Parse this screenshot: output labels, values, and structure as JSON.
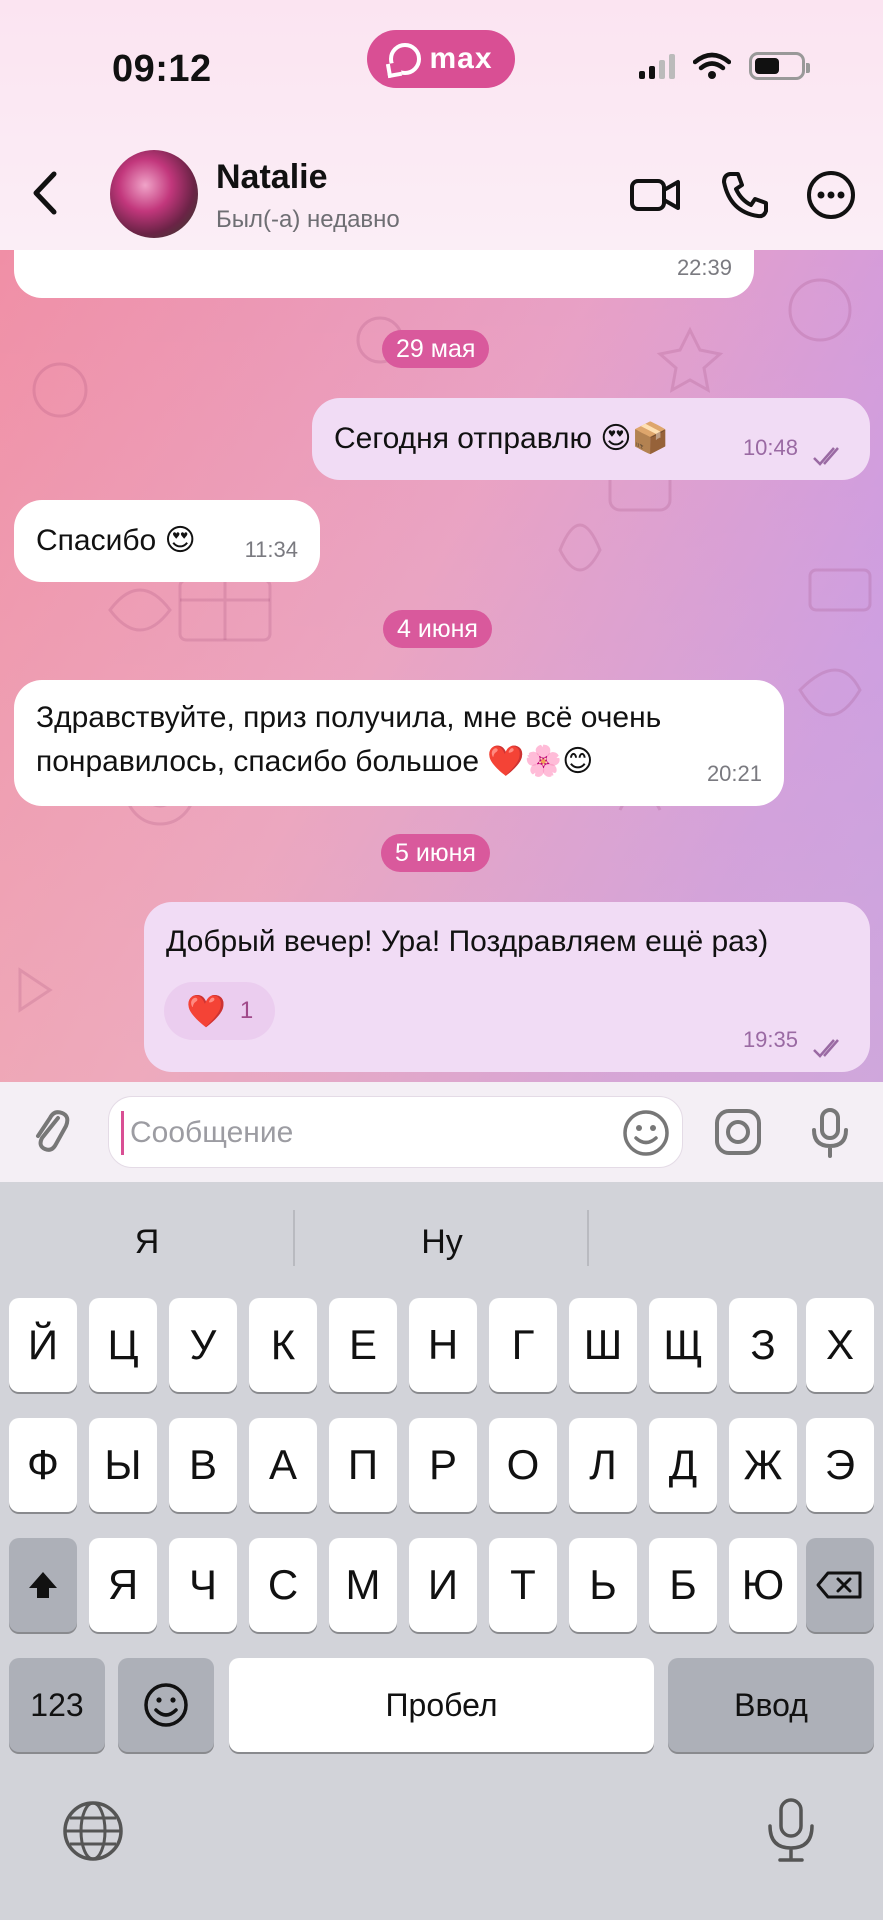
{
  "status_bar": {
    "time": "09:12",
    "app_badge": "max"
  },
  "header": {
    "contact_name": "Natalie",
    "contact_status": "Был(-а) недавно"
  },
  "chat": {
    "partial_top_time": "22:39",
    "date_1": "29 мая",
    "msg_1": {
      "text": "Сегодня отправлю 😍📦",
      "time": "10:48"
    },
    "msg_2": {
      "text": "Спасибо 😍",
      "time": "11:34"
    },
    "date_2": "4 июня",
    "msg_3": {
      "line1": "Здравствуйте, приз получила, мне всё очень",
      "line2": "понравилось, спасибо большое ❤️🌸😊",
      "time": "20:21"
    },
    "date_3": "5 июня",
    "msg_4": {
      "text": "Добрый вечер! Ура! Поздравляем ещё раз)",
      "time": "19:35",
      "reaction_emoji": "❤️",
      "reaction_count": "1"
    }
  },
  "composer": {
    "placeholder": "Сообщение"
  },
  "keyboard": {
    "suggestions": [
      "Я",
      "Ну",
      ""
    ],
    "row1": [
      "Й",
      "Ц",
      "У",
      "К",
      "Е",
      "Н",
      "Г",
      "Ш",
      "Щ",
      "З",
      "Х"
    ],
    "row2": [
      "Ф",
      "Ы",
      "В",
      "А",
      "П",
      "Р",
      "О",
      "Л",
      "Д",
      "Ж",
      "Э"
    ],
    "row3": [
      "Я",
      "Ч",
      "С",
      "М",
      "И",
      "Т",
      "Ь",
      "Б",
      "Ю"
    ],
    "numbers_key": "123",
    "space_key": "Пробел",
    "return_key": "Ввод"
  }
}
